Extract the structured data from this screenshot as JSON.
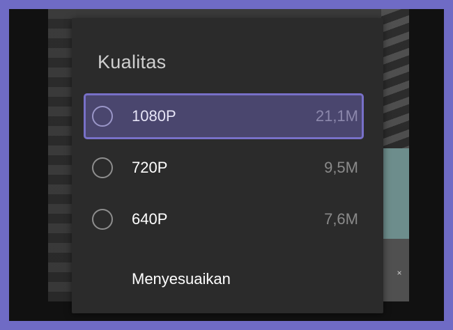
{
  "dialog": {
    "title": "Kualitas",
    "options": [
      {
        "label": "1080P",
        "size": "21,1M",
        "selected": true
      },
      {
        "label": "720P",
        "size": "9,5M",
        "selected": false
      },
      {
        "label": "640P",
        "size": "7,6M",
        "selected": false
      }
    ],
    "custom_label": "Menyesuaikan"
  },
  "background": {
    "ad_close_glyph": "×"
  },
  "colors": {
    "page_border": "#6f6bc5",
    "dialog_bg": "#2b2b2b",
    "selected_bg": "#4a466e",
    "selected_border": "#7870c8"
  },
  "icons": [
    "radio-unchecked-icon",
    "close-icon"
  ]
}
